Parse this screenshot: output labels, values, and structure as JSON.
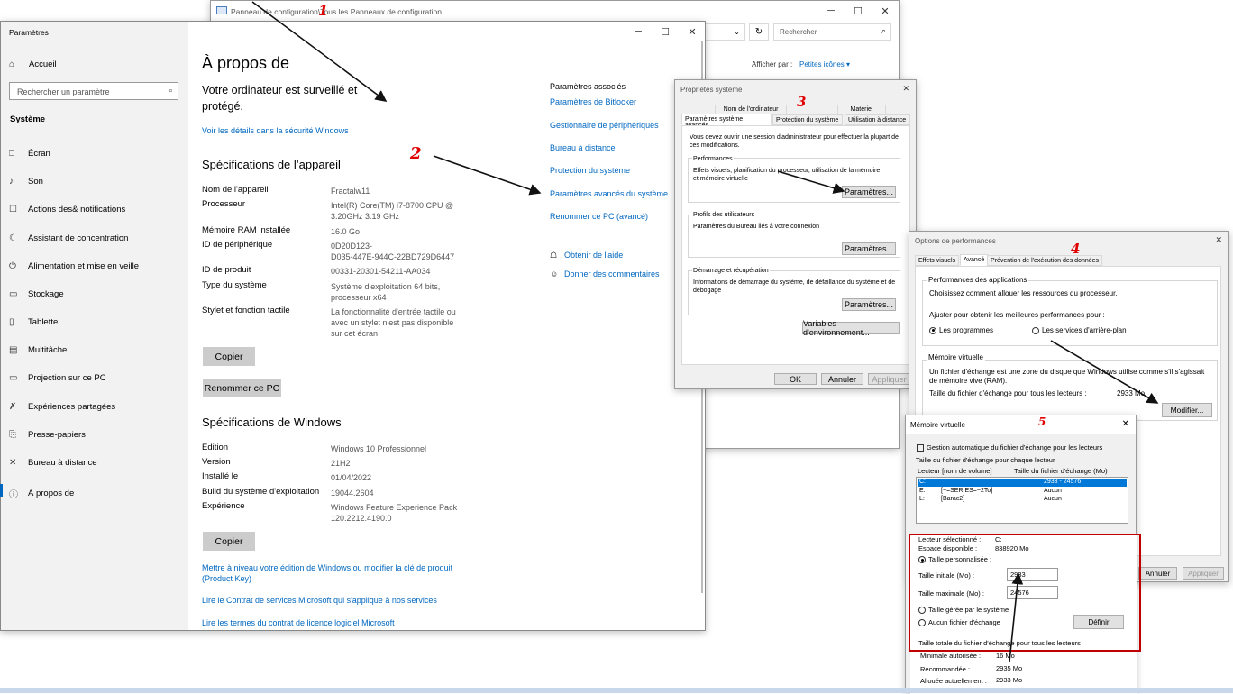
{
  "cp": {
    "title": "Panneau de configuration\\Tous les Panneaux de configuration",
    "search_placeholder": "Rechercher",
    "view_label": "Afficher par :",
    "view_value": "Petites icônes"
  },
  "settings": {
    "app_title": "Paramètres",
    "home": "Accueil",
    "search_placeholder": "Rechercher un paramètre",
    "section": "Système",
    "nav": [
      {
        "icon": "⎕",
        "label": "Écran"
      },
      {
        "icon": "♪",
        "label": "Son"
      },
      {
        "icon": "☐",
        "label": "Actions des& notifications"
      },
      {
        "icon": "☾",
        "label": "Assistant de concentration"
      },
      {
        "icon": "⏻",
        "label": "Alimentation et mise en veille"
      },
      {
        "icon": "▭",
        "label": "Stockage"
      },
      {
        "icon": "▯",
        "label": "Tablette"
      },
      {
        "icon": "▤",
        "label": "Multitâche"
      },
      {
        "icon": "▭",
        "label": "Projection sur ce PC"
      },
      {
        "icon": "✗",
        "label": "Expériences partagées"
      },
      {
        "icon": "⎘",
        "label": "Presse-papiers"
      },
      {
        "icon": "✕",
        "label": "Bureau à distance"
      },
      {
        "icon": "ⓘ",
        "label": "À propos de"
      }
    ],
    "page_title": "À propos de",
    "protect_line1": "Votre ordinateur est surveillé et",
    "protect_line2": "protégé.",
    "security_link": "Voir les détails dans la sécurité Windows",
    "device_spec_title": "Spécifications de l’appareil",
    "device_specs": [
      {
        "label": "Nom de l'appareil",
        "value": [
          "Fractalw11"
        ]
      },
      {
        "label": "Processeur",
        "value": [
          "Intel(R) Core(TM) i7-8700 CPU @",
          "3.20GHz   3.19 GHz"
        ]
      },
      {
        "label": "Mémoire RAM installée",
        "value": [
          "16.0 Go"
        ]
      },
      {
        "label": "ID de périphérique",
        "value": [
          "0D20D123-",
          "D035-447E-944C-22BD729D6447"
        ]
      },
      {
        "label": "ID de produit",
        "value": [
          "00331-20301-54211-AA034"
        ]
      },
      {
        "label": "Type du système",
        "value": [
          "Système d'exploitation 64 bits,",
          "processeur x64"
        ]
      },
      {
        "label": "Stylet et fonction tactile",
        "value": [
          "La fonctionnalité d'entrée tactile ou",
          "avec un stylet n'est pas disponible",
          "sur cet écran"
        ]
      }
    ],
    "copy_btn": "Copier",
    "rename_btn": "Renommer ce PC",
    "win_spec_title": "Spécifications de Windows",
    "win_specs": [
      {
        "label": "Édition",
        "value": [
          "Windows 10 Professionnel"
        ]
      },
      {
        "label": "Version",
        "value": [
          "21H2"
        ]
      },
      {
        "label": "Installé le",
        "value": [
          "01/04/2022"
        ]
      },
      {
        "label": "Build du système d'exploitation",
        "value": [
          "19044.2604"
        ]
      },
      {
        "label": "Expérience",
        "value": [
          "Windows Feature Experience Pack",
          "120.2212.4190.0"
        ]
      }
    ],
    "copy_btn2": "Copier",
    "upgrade_link1": "Mettre à niveau votre édition de Windows ou modifier la clé de produit",
    "upgrade_link2": "(Product Key)",
    "contract_link": "Lire le Contrat de services Microsoft qui s'applique à nos services",
    "license_link": "Lire les termes du contrat de licence logiciel Microsoft",
    "related_title": "Paramètres associés",
    "related": [
      "Paramètres de Bitlocker",
      "Gestionnaire de périphériques",
      "Bureau à distance",
      "Protection du système",
      "Paramètres avancés du système",
      "Renommer ce PC (avancé)"
    ],
    "help": "Obtenir de l'aide",
    "feedback": "Donner des commentaires"
  },
  "sysprops": {
    "title": "Propriétés système",
    "tabs_top": [
      "Nom de l'ordinateur",
      "Matériel"
    ],
    "tabs_bottom": [
      "Paramètres système avancés",
      "Protection du système",
      "Utilisation à distance"
    ],
    "admin_note": "Vous devez ouvrir une session d'administrateur pour effectuer la plupart de ces modifications.",
    "perf_title": "Performances",
    "perf_desc": "Effets visuels, planification du processeur, utilisation de la mémoire et mémoire virtuelle",
    "perf_btn": "Paramètres...",
    "profiles_title": "Profils des utilisateurs",
    "profiles_desc": "Paramètres du Bureau liés à votre connexion",
    "profiles_btn": "Paramètres...",
    "startup_title": "Démarrage et récupération",
    "startup_desc": "Informations de démarrage du système, de défaillance du système et de débogage",
    "startup_btn": "Paramètres...",
    "env_btn": "Variables d'environnement...",
    "ok": "OK",
    "cancel": "Annuler",
    "apply": "Appliquer"
  },
  "perfopts": {
    "title": "Options de performances",
    "tabs": [
      "Effets visuels",
      "Avancé",
      "Prévention de l'exécution des données"
    ],
    "app_perf_title": "Performances des applications",
    "app_perf_desc": "Choisissez comment allouer les ressources du processeur.",
    "adjust": "Ajuster pour obtenir les meilleures performances pour :",
    "opt_programs": "Les programmes",
    "opt_services": "Les services d'arrière-plan",
    "vm_title": "Mémoire virtuelle",
    "vm_desc": "Un fichier d'échange est une zone du disque que Windows utilise comme s'il s'agissait de mémoire vive (RAM).",
    "vm_total_label": "Taille du fichier d'échange pour tous les lecteurs :",
    "vm_total_value": "2933 Mo",
    "modify_btn": "Modifier...",
    "cancel": "Annuler",
    "apply": "Appliquer"
  },
  "vmem": {
    "title": "Mémoire virtuelle",
    "auto_label": "Gestion automatique du fichier d'échange pour les lecteurs",
    "per_drive_title": "Taille du fichier d'échange pour chaque lecteur",
    "col_drive": "Lecteur [nom de volume]",
    "col_size": "Taille du fichier d'échange (Mo)",
    "drives": [
      {
        "drive": "C:",
        "name": "",
        "size": "2933 - 24576"
      },
      {
        "drive": "E:",
        "name": "[~=SERIES=~2To]",
        "size": "Aucun"
      },
      {
        "drive": "L:",
        "name": "[Barac2]",
        "size": "Aucun"
      }
    ],
    "selected_label": "Lecteur sélectionné :",
    "selected_value": "C:",
    "space_label": "Espace disponible :",
    "space_value": "838920 Mo",
    "custom_size": "Taille personnalisée :",
    "initial_label": "Taille initiale (Mo) :",
    "initial_value": "2933",
    "max_label": "Taille maximale (Mo) :",
    "max_value": "24576",
    "system_managed": "Taille gérée par le système",
    "no_file": "Aucun fichier d'échange",
    "define_btn": "Définir",
    "total_title": "Taille totale du fichier d'échange pour tous les lecteurs",
    "min_label": "Minimale autorisée :",
    "min_value": "16 Mo",
    "rec_label": "Recommandée :",
    "rec_value": "2935 Mo",
    "alloc_label": "Allouée actuellement :",
    "alloc_value": "2933 Mo"
  },
  "annotations": {
    "n1": "1",
    "n2": "2",
    "n3": "3",
    "n4": "4",
    "n5": "5"
  },
  "colors": {
    "accent": "#0067c0",
    "annotation": "#e00000",
    "highlight": "#c00000",
    "selection": "#0078d7"
  }
}
